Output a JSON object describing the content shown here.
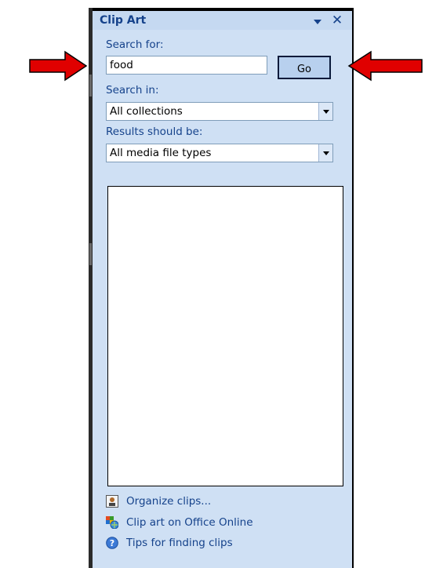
{
  "pane": {
    "title": "Clip Art",
    "search_for_label": "Search for:",
    "search_value": "food",
    "go_label": "Go",
    "search_in_label": "Search in:",
    "search_in_value": "All collections",
    "results_label": "Results should be:",
    "results_value": "All media file types"
  },
  "links": {
    "organize": "Organize clips...",
    "office_online": "Clip art on Office Online",
    "tips": "Tips for finding clips"
  },
  "annotations": {
    "arrow_color": "#e00000"
  },
  "colors": {
    "pane_bg": "#cfe0f4",
    "title_text": "#15428b"
  }
}
